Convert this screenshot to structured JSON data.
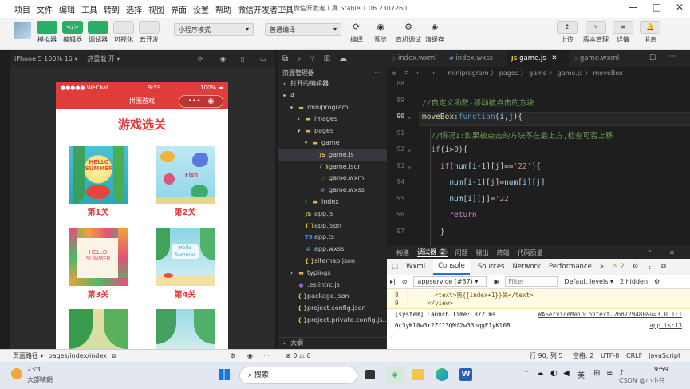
{
  "titlebar": {
    "menu": [
      "项目",
      "文件",
      "编辑",
      "工具",
      "转到",
      "选择",
      "视图",
      "界面",
      "设置",
      "帮助",
      "微信开发者工具"
    ],
    "title": "4 - 微信开发者工具 Stable 1.06.2307260",
    "win_buttons": [
      "—",
      "□",
      "✕"
    ]
  },
  "toolbar": {
    "left_buttons": [
      {
        "label": "模拟器",
        "icon": "phone-icon"
      },
      {
        "label": "编辑器",
        "icon": "code-icon"
      },
      {
        "label": "调试器",
        "icon": "debug-icon"
      },
      {
        "label": "可视化",
        "icon": "visual-icon"
      },
      {
        "label": "云开发",
        "icon": "cloud-icon"
      }
    ],
    "mode_select": "小程序模式",
    "compile_select": "普通编译",
    "mid_buttons": [
      "编译",
      "预览",
      "真机调试",
      "清缓存"
    ],
    "right_buttons": [
      "上传",
      "版本管理",
      "详情",
      "消息"
    ]
  },
  "simulator": {
    "device": "iPhone 5 100% 16 ▾",
    "hotreload": "热重载 开 ▾",
    "carrier": "●●●●● WeChat",
    "time": "9:59",
    "battery": "100%",
    "nav_title": "拼图游戏",
    "heading": "游戏选关",
    "levels": [
      "第1关",
      "第2关",
      "第3关",
      "第4关",
      "",
      ""
    ]
  },
  "explorer": {
    "tabs_icons": [
      "files-icon",
      "search-icon",
      "branch-icon",
      "extensions-icon",
      "cloud-icon"
    ],
    "header": "资源管理器",
    "open_editors": "打开的编辑器",
    "tree": [
      {
        "indent": 0,
        "arrow": "▾",
        "icon": "",
        "name": "4"
      },
      {
        "indent": 1,
        "arrow": "▾",
        "icon": "folder",
        "name": "miniprogram"
      },
      {
        "indent": 2,
        "arrow": "›",
        "icon": "folder",
        "name": "images"
      },
      {
        "indent": 2,
        "arrow": "▾",
        "icon": "folder",
        "name": "pages"
      },
      {
        "indent": 3,
        "arrow": "▾",
        "icon": "folder",
        "name": "game"
      },
      {
        "indent": 4,
        "arrow": "",
        "icon": "js",
        "name": "game.js",
        "selected": true
      },
      {
        "indent": 4,
        "arrow": "",
        "icon": "json",
        "name": "game.json"
      },
      {
        "indent": 4,
        "arrow": "",
        "icon": "wxml",
        "name": "game.wxml"
      },
      {
        "indent": 4,
        "arrow": "",
        "icon": "wxss",
        "name": "game.wxss"
      },
      {
        "indent": 3,
        "arrow": "›",
        "icon": "folder",
        "name": "index"
      },
      {
        "indent": 2,
        "arrow": "",
        "icon": "js",
        "name": "app.js"
      },
      {
        "indent": 2,
        "arrow": "",
        "icon": "json",
        "name": "app.json"
      },
      {
        "indent": 2,
        "arrow": "",
        "icon": "ts",
        "name": "app.ts"
      },
      {
        "indent": 2,
        "arrow": "",
        "icon": "wxss",
        "name": "app.wxss"
      },
      {
        "indent": 2,
        "arrow": "",
        "icon": "json",
        "name": "sitemap.json"
      },
      {
        "indent": 1,
        "arrow": "›",
        "icon": "folder",
        "name": "typings"
      },
      {
        "indent": 1,
        "arrow": "",
        "icon": "dot",
        "name": ".eslintrc.js"
      },
      {
        "indent": 1,
        "arrow": "",
        "icon": "json",
        "name": "package.json"
      },
      {
        "indent": 1,
        "arrow": "",
        "icon": "json",
        "name": "project.config.json"
      },
      {
        "indent": 1,
        "arrow": "",
        "icon": "json",
        "name": "project.private.config.js..."
      }
    ],
    "outline": "大纲"
  },
  "editor": {
    "tabs": [
      {
        "name": "index.wxml",
        "icon": "wxml"
      },
      {
        "name": "index.wxss",
        "icon": "wxss"
      },
      {
        "name": "game.js",
        "icon": "js",
        "active": true
      },
      {
        "name": "game.wxml",
        "icon": "wxml"
      }
    ],
    "breadcrumb": "miniprogram 〉 pages 〉 game 〉 game.js 〉 moveBox",
    "lines": [
      {
        "n": "88",
        "html": ""
      },
      {
        "n": "89",
        "html": "<span class='cm'>//自定义函数-移动被点击的方块</span>"
      },
      {
        "n": "90",
        "html": "<span class='fn'>moveBox</span>:<span class='kw'>function</span>(<span class='var'>i</span>,<span class='var'>j</span>){"
      },
      {
        "n": "91",
        "html": "  <span class='cm'>//情况1:如果被点击的方块不在最上方,检查可否上移</span>"
      },
      {
        "n": "92",
        "html": "  <span class='pk'>if</span>(<span class='var'>i</span>&gt;<span class='nm'>0</span>){"
      },
      {
        "n": "93",
        "html": "    <span class='pk'>if</span>(<span class='var'>num</span>[<span class='var'>i</span>-<span class='nm'>1</span>][<span class='var'>j</span>]==<span class='st'>'22'</span>){"
      },
      {
        "n": "94",
        "html": "      <span class='var'>num</span>[<span class='var'>i</span>-<span class='nm'>1</span>][<span class='var'>j</span>]=<span class='var'>num</span>[<span class='var'>i</span>][<span class='var'>j</span>]"
      },
      {
        "n": "95",
        "html": "      <span class='var'>num</span>[<span class='var'>i</span>][<span class='var'>j</span>]=<span class='st'>'22'</span>"
      },
      {
        "n": "96",
        "html": "      <span class='pk'>return</span>"
      },
      {
        "n": "97",
        "html": "    }"
      }
    ]
  },
  "panel": {
    "tabs": [
      "构建",
      "调试器",
      "2",
      "问题",
      "输出",
      "终端",
      "代码质量"
    ],
    "devtools_tabs": [
      "Wxml",
      "Console",
      "Sources",
      "Network",
      "Performance",
      "»"
    ],
    "warnings": "⚠ 2",
    "context": "appservice (#37)",
    "filter_placeholder": "Filter",
    "levels": "Default levels ▾",
    "hidden": "2 hidden",
    "code_lines": [
      {
        "n": "8",
        "text": "      <text>第{{index+1}}关</text>"
      },
      {
        "n": "9",
        "text": "    </view>"
      }
    ],
    "log1": "[system] Launch Time: 872 ms",
    "log1_src": "WAServiceMainContext…268729480&v=3.0.1:1",
    "log2": "0c3yKl0w3r2Zf13QMf2w33pqgE1yKl0B",
    "log2_src": "app.ts:13"
  },
  "statusbar": {
    "path_label": "页面路径 ▾",
    "path": "pages/index/index",
    "problems": "⊗ 0 ⚠ 0",
    "position": "行 90, 列 5",
    "spaces": "空格: 2",
    "encoding": "UTF-8",
    "eol": "CRLF",
    "language": "JavaScript"
  },
  "taskbar": {
    "temp": "23°C",
    "weather": "大部晴朗",
    "search": "搜索",
    "tray_lang": "英",
    "time": "9:59",
    "watermark": "CSDN @小小只"
  }
}
